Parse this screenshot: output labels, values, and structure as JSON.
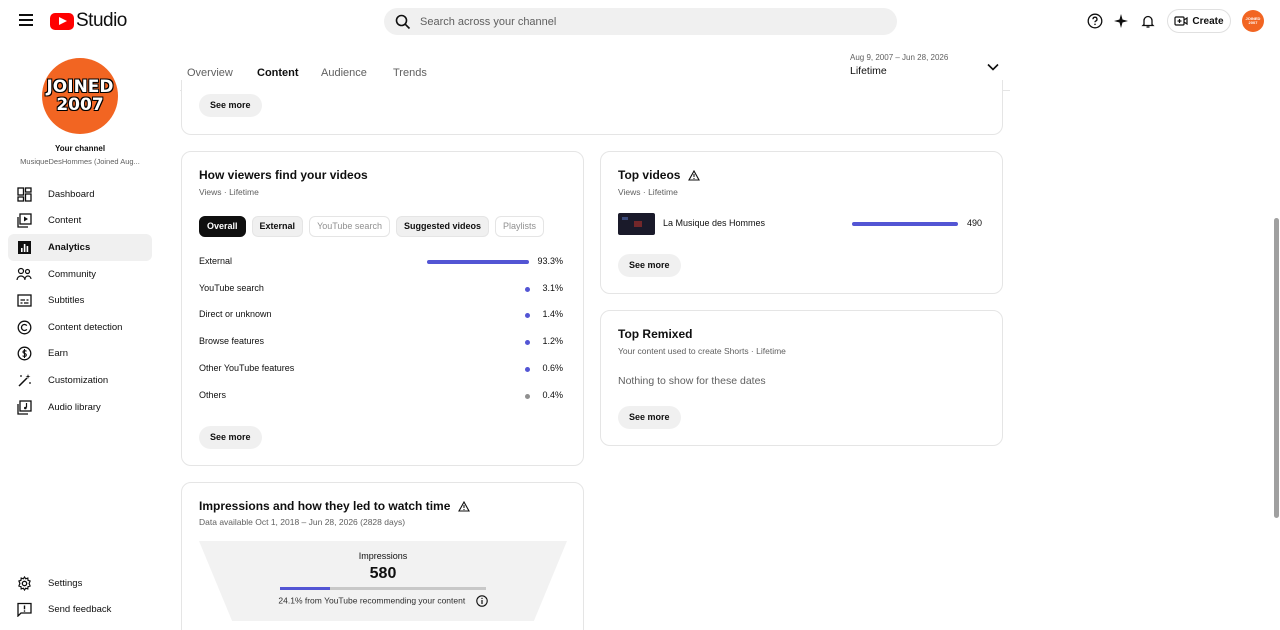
{
  "header": {
    "logo_text": "Studio",
    "search_placeholder": "Search across your channel",
    "create_label": "Create",
    "avatar_text_1": "JOINED",
    "avatar_text_2": "2007"
  },
  "sidebar": {
    "avatar_line1": "JOINED",
    "avatar_line2": "2007",
    "your_channel": "Your channel",
    "channel_name": "MusiqueDesHommes (Joined Aug...",
    "items": [
      {
        "label": "Dashboard",
        "icon": "dashboard-icon"
      },
      {
        "label": "Content",
        "icon": "content-icon"
      },
      {
        "label": "Analytics",
        "icon": "analytics-icon",
        "active": true
      },
      {
        "label": "Community",
        "icon": "community-icon"
      },
      {
        "label": "Subtitles",
        "icon": "subtitles-icon"
      },
      {
        "label": "Content detection",
        "icon": "copyright-icon"
      },
      {
        "label": "Earn",
        "icon": "dollar-icon"
      },
      {
        "label": "Customization",
        "icon": "magic-wand-icon"
      },
      {
        "label": "Audio library",
        "icon": "audio-library-icon"
      }
    ],
    "bottom": [
      {
        "label": "Settings",
        "icon": "gear-icon"
      },
      {
        "label": "Send feedback",
        "icon": "feedback-icon"
      }
    ]
  },
  "tabs": [
    "Overview",
    "Content",
    "Audience",
    "Trends"
  ],
  "date_range": {
    "dates": "Aug 9, 2007 – Jun 28, 2026",
    "label": "Lifetime"
  },
  "top_card": {
    "see_more": "See more"
  },
  "traffic": {
    "title": "How viewers find your videos",
    "subtitle": "Views · Lifetime",
    "chips": [
      "Overall",
      "External",
      "YouTube search",
      "Suggested videos",
      "Playlists"
    ],
    "rows": [
      {
        "source": "External",
        "pct": "93.3%",
        "value": 93.3
      },
      {
        "source": "YouTube search",
        "pct": "3.1%",
        "value": 3.1
      },
      {
        "source": "Direct or unknown",
        "pct": "1.4%",
        "value": 1.4
      },
      {
        "source": "Browse features",
        "pct": "1.2%",
        "value": 1.2
      },
      {
        "source": "Other YouTube features",
        "pct": "0.6%",
        "value": 0.6
      },
      {
        "source": "Others",
        "pct": "0.4%",
        "value": 0.4
      }
    ],
    "see_more": "See more"
  },
  "top_videos": {
    "title": "Top videos",
    "subtitle": "Views · Lifetime",
    "video_title": "La Musique des Hommes",
    "views": "490",
    "see_more": "See more"
  },
  "top_remixed": {
    "title": "Top Remixed",
    "subtitle": "Your content used to create Shorts · Lifetime",
    "empty": "Nothing to show for these dates",
    "see_more": "See more"
  },
  "impressions": {
    "title": "Impressions and how they led to watch time",
    "subtitle": "Data available Oct 1, 2018 – Jun 28, 2026 (2828 days)",
    "label": "Impressions",
    "value": "580",
    "note": "24.1% from YouTube recommending your content",
    "recommend_fraction": 0.241
  },
  "colors": {
    "accent": "#5355d4",
    "brand": "#ff0000",
    "avatar": "#f26522"
  }
}
